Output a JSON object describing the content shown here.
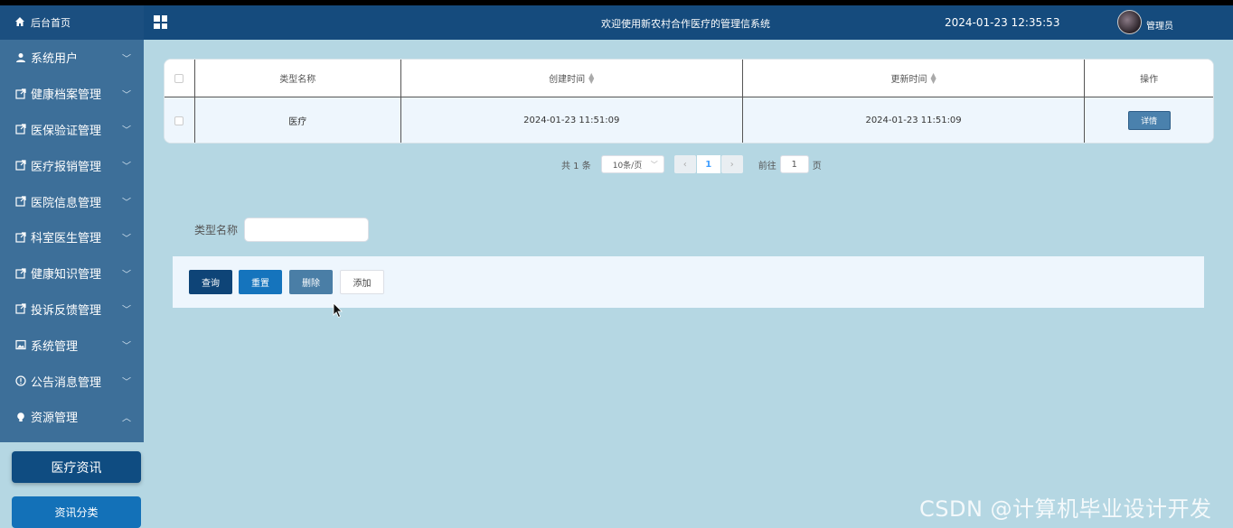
{
  "header": {
    "title": "欢迎使用新农村合作医疗的管理信系统",
    "datetime": "2024-01-23 12:35:53",
    "user": "管理员"
  },
  "sidebar": {
    "home": "后台首页",
    "items": [
      {
        "label": "系统用户",
        "icon": "user-icon",
        "chevron": "down"
      },
      {
        "label": "健康档案管理",
        "icon": "external-icon",
        "chevron": "down"
      },
      {
        "label": "医保验证管理",
        "icon": "external-icon",
        "chevron": "down"
      },
      {
        "label": "医疗报销管理",
        "icon": "external-icon",
        "chevron": "down"
      },
      {
        "label": "医院信息管理",
        "icon": "external-icon",
        "chevron": "down"
      },
      {
        "label": "科室医生管理",
        "icon": "external-icon",
        "chevron": "down"
      },
      {
        "label": "健康知识管理",
        "icon": "external-icon",
        "chevron": "down"
      },
      {
        "label": "投诉反馈管理",
        "icon": "external-icon",
        "chevron": "down"
      },
      {
        "label": "系统管理",
        "icon": "picture-icon",
        "chevron": "down"
      },
      {
        "label": "公告消息管理",
        "icon": "info-icon",
        "chevron": "down"
      },
      {
        "label": "资源管理",
        "icon": "bulb-icon",
        "chevron": "up"
      }
    ],
    "sub_active": "医疗资讯",
    "sub_item": "资讯分类"
  },
  "table": {
    "columns": [
      "类型名称",
      "创建时间",
      "更新时间",
      "操作"
    ],
    "rows": [
      {
        "name": "医疗",
        "created": "2024-01-23 11:51:09",
        "updated": "2024-01-23 11:51:09",
        "action": "详情"
      }
    ]
  },
  "pagination": {
    "total": "共 1 条",
    "page_size": "10条/页",
    "current": "1",
    "goto_label": "前往",
    "goto_value": "1",
    "page_suffix": "页"
  },
  "search": {
    "label": "类型名称",
    "value": ""
  },
  "actions": {
    "query": "查询",
    "reset": "重置",
    "delete": "删除",
    "add": "添加"
  },
  "watermark": "CSDN @计算机毕业设计开发"
}
